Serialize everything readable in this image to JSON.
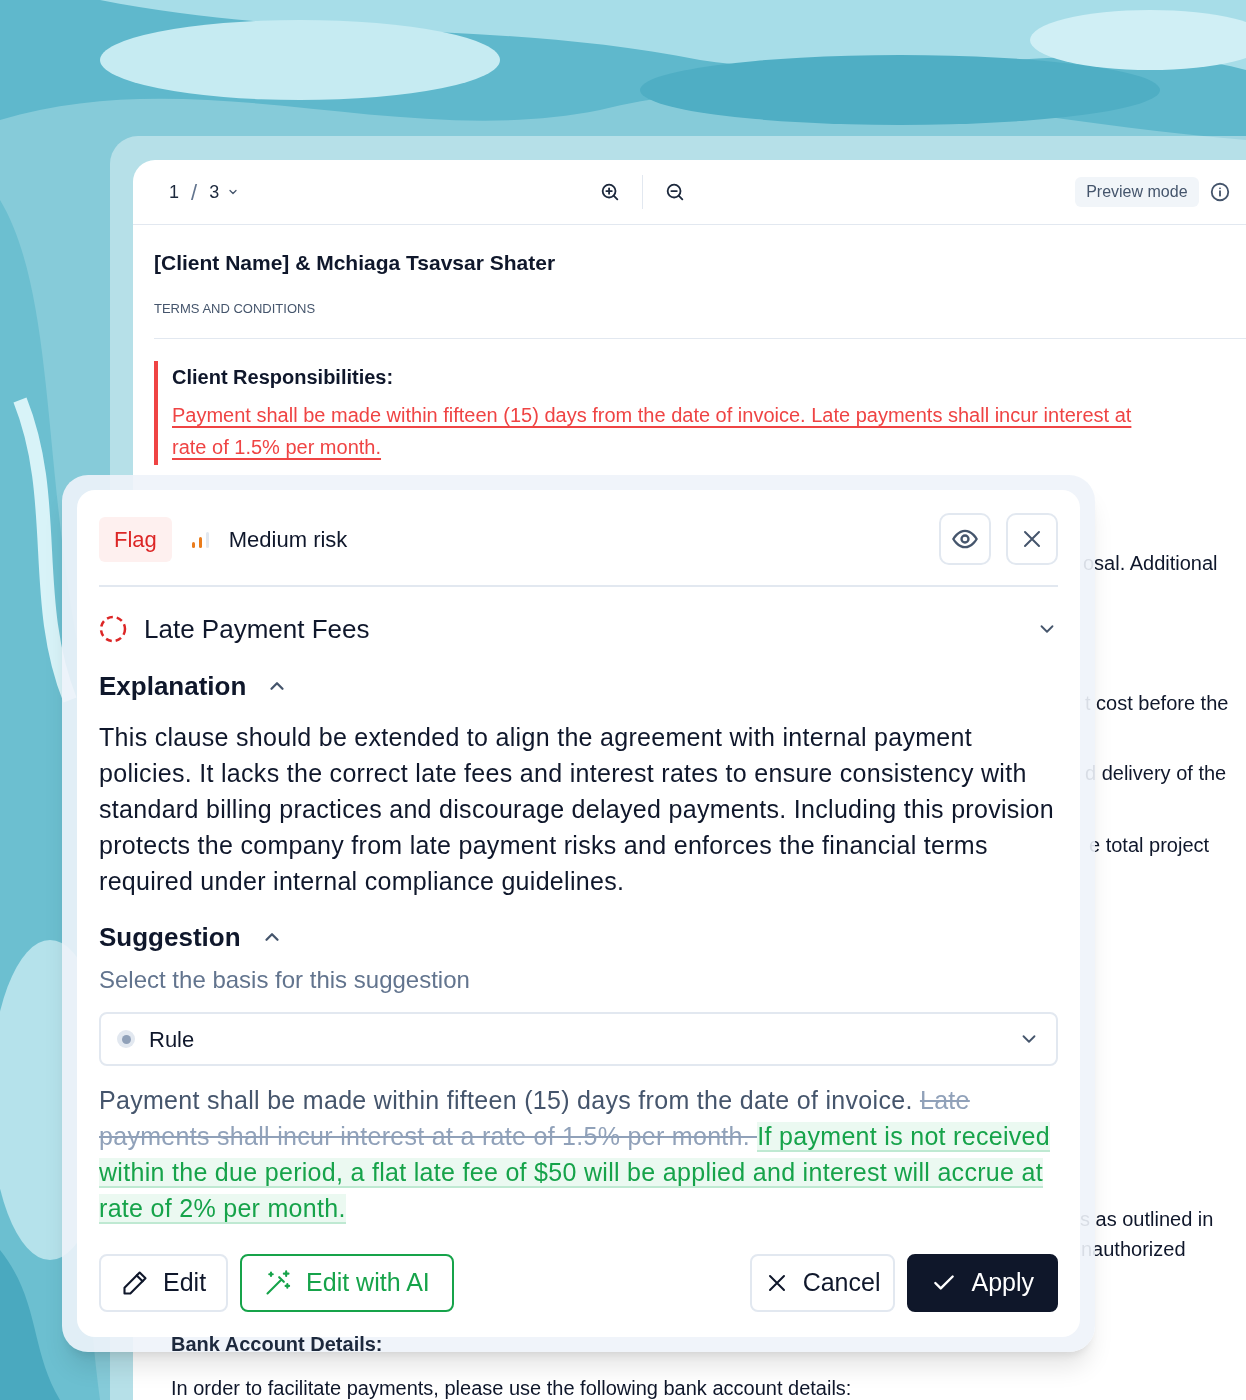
{
  "document": {
    "toolbar": {
      "page": "1",
      "separator": "/",
      "page_count": "3",
      "mode": "Preview mode"
    },
    "title": "[Client Name] & Mchiaga Tsavsar Shater",
    "subtitle": "TERMS AND CONDITIONS",
    "flagged_section": {
      "heading": "Client Responsibilities:",
      "lines": [
        "Payment shall be made within fifteen (15) days from the date of invoice. Late payments shall incur interest at",
        "rate of 1.5% per month."
      ]
    },
    "fragments": [
      "osal. Additional",
      "t cost before the",
      "d delivery of the",
      "e total project",
      "s as outlined in",
      "nauthorized"
    ],
    "bank_heading": "Bank Account Details:",
    "bank_text": "In order to facilitate payments, please use the following bank account details:"
  },
  "card": {
    "badge": "Flag",
    "risk": {
      "label": "Medium risk",
      "level": 0.67
    },
    "issue": "Late Payment Fees",
    "explanation": {
      "heading": "Explanation",
      "expanded": true,
      "text": "This clause should be extended to align the agreement with internal payment policies. It lacks the correct late fees and interest rates to ensure consistency with standard billing practices and discourage delayed payments. Including this provision protects the company from late payment risks and enforces the financial terms required under internal compliance guidelines."
    },
    "suggestion": {
      "heading": "Suggestion",
      "expanded": true,
      "prompt": "Select the basis for this suggestion",
      "select": "Rule",
      "segments": [
        {
          "kind": "kept",
          "text": "Payment shall be made within fifteen (15) days from the date of invoice. "
        },
        {
          "kind": "removed",
          "text": "Late payments shall incur interest at a rate of 1.5% per month. "
        },
        {
          "kind": "added",
          "text": "If payment is not received within the due period, a flat late fee of $50 will be applied and interest will accrue at rate of 2% per month. "
        }
      ]
    },
    "buttons": [
      {
        "kind": "edit",
        "label": "Edit"
      },
      {
        "kind": "ai",
        "label": "Edit with AI"
      },
      {
        "kind": "cancel",
        "label": "Cancel"
      },
      {
        "kind": "apply",
        "label": "Apply"
      }
    ]
  }
}
